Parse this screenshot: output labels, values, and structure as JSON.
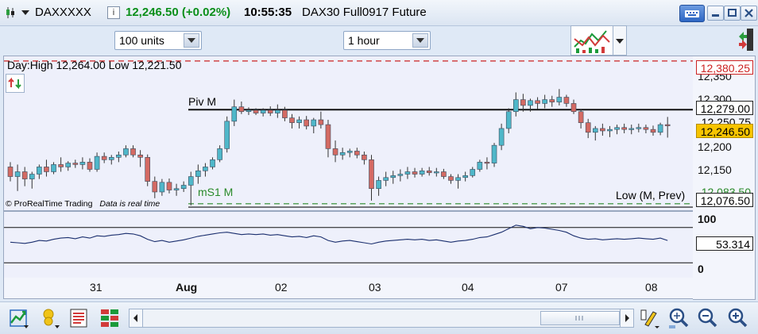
{
  "titlebar": {
    "symbol": "DAXXXXX",
    "price_change": "12,246.50 (+0.02%)",
    "time": "10:55:35",
    "instrument": "DAX30 Full0917 Future",
    "colors": {
      "price_change": "#0b8f1a"
    }
  },
  "toolbar": {
    "units_select": "100 units",
    "timeframe_select": "1 hour"
  },
  "chart": {
    "day_range": "Day:High 12,264.00 Low 12,221.50",
    "piv_label": "Piv M",
    "ms1_label": "mS1 M",
    "low_label": "Low (M, Prev)",
    "footer": "© ProRealTime Trading",
    "footer_note": "Data is real time",
    "oscillator_value": "53.314",
    "colors": {
      "up": "#4fb7c9",
      "down": "#d46a63",
      "resistance": "#cc2222",
      "support": "#2a8a2a",
      "current": "#f6c400"
    }
  },
  "chart_data": {
    "type": "candlestick",
    "x_ticks": [
      "31",
      "Aug",
      "02",
      "03",
      "04",
      "07",
      "08"
    ],
    "y_ticks": [
      12350,
      12300,
      12250,
      12200,
      12150,
      12100
    ],
    "ylim": [
      12070,
      12390
    ],
    "levels": [
      {
        "label": "12,380.25",
        "value": 12380.25
      },
      {
        "label": "12,279.00",
        "value": 12279.0
      },
      {
        "label": "12,250.75",
        "value": 12250.75
      },
      {
        "label": "12,246.50",
        "value": 12246.5
      },
      {
        "label": "12,083.50",
        "value": 12083.5
      },
      {
        "label": "12,076.50",
        "value": 12076.5
      }
    ],
    "osc_ticks": [
      "100",
      "0"
    ],
    "osc_range": [
      0,
      100
    ],
    "osc_bands": [
      80,
      20
    ],
    "candles": [
      [
        12160,
        12170,
        12130,
        12140
      ],
      [
        12140,
        12165,
        12110,
        12150
      ],
      [
        12150,
        12160,
        12120,
        12135
      ],
      [
        12135,
        12150,
        12115,
        12145
      ],
      [
        12145,
        12165,
        12135,
        12160
      ],
      [
        12160,
        12175,
        12140,
        12150
      ],
      [
        12150,
        12170,
        12145,
        12165
      ],
      [
        12165,
        12180,
        12150,
        12160
      ],
      [
        12160,
        12172,
        12152,
        12168
      ],
      [
        12168,
        12175,
        12158,
        12165
      ],
      [
        12165,
        12180,
        12155,
        12170
      ],
      [
        12170,
        12178,
        12150,
        12155
      ],
      [
        12155,
        12190,
        12150,
        12182
      ],
      [
        12182,
        12190,
        12168,
        12175
      ],
      [
        12175,
        12185,
        12165,
        12180
      ],
      [
        12180,
        12192,
        12170,
        12185
      ],
      [
        12185,
        12205,
        12180,
        12198
      ],
      [
        12198,
        12205,
        12180,
        12185
      ],
      [
        12185,
        12195,
        12160,
        12180
      ],
      [
        12180,
        12186,
        12120,
        12130
      ],
      [
        12130,
        12140,
        12095,
        12108
      ],
      [
        12108,
        12135,
        12100,
        12128
      ],
      [
        12128,
        12136,
        12105,
        12112
      ],
      [
        12112,
        12125,
        12100,
        12115
      ],
      [
        12115,
        12130,
        12108,
        12122
      ],
      [
        12122,
        12150,
        12080,
        12140
      ],
      [
        12140,
        12165,
        12125,
        12152
      ],
      [
        12152,
        12168,
        12140,
        12160
      ],
      [
        12160,
        12180,
        12155,
        12175
      ],
      [
        12175,
        12205,
        12170,
        12198
      ],
      [
        12198,
        12265,
        12190,
        12255
      ],
      [
        12255,
        12300,
        12245,
        12285
      ],
      [
        12285,
        12296,
        12270,
        12275
      ],
      [
        12275,
        12284,
        12268,
        12278
      ],
      [
        12278,
        12282,
        12268,
        12272
      ],
      [
        12272,
        12282,
        12265,
        12278
      ],
      [
        12278,
        12286,
        12266,
        12272
      ],
      [
        12272,
        12290,
        12262,
        12278
      ],
      [
        12278,
        12285,
        12255,
        12262
      ],
      [
        12262,
        12270,
        12240,
        12252
      ],
      [
        12252,
        12265,
        12240,
        12258
      ],
      [
        12258,
        12266,
        12238,
        12245
      ],
      [
        12245,
        12262,
        12230,
        12258
      ],
      [
        12258,
        12275,
        12240,
        12248
      ],
      [
        12248,
        12258,
        12180,
        12198
      ],
      [
        12198,
        12215,
        12170,
        12185
      ],
      [
        12185,
        12200,
        12175,
        12190
      ],
      [
        12190,
        12198,
        12180,
        12193
      ],
      [
        12193,
        12200,
        12178,
        12185
      ],
      [
        12185,
        12192,
        12165,
        12175
      ],
      [
        12175,
        12185,
        12090,
        12115
      ],
      [
        12115,
        12140,
        12100,
        12132
      ],
      [
        12132,
        12150,
        12120,
        12138
      ],
      [
        12138,
        12152,
        12125,
        12142
      ],
      [
        12142,
        12155,
        12130,
        12145
      ],
      [
        12145,
        12160,
        12135,
        12150
      ],
      [
        12150,
        12158,
        12138,
        12145
      ],
      [
        12145,
        12158,
        12140,
        12152
      ],
      [
        12152,
        12160,
        12142,
        12148
      ],
      [
        12148,
        12158,
        12140,
        12150
      ],
      [
        12150,
        12156,
        12135,
        12140
      ],
      [
        12140,
        12145,
        12125,
        12132
      ],
      [
        12132,
        12145,
        12115,
        12138
      ],
      [
        12138,
        12150,
        12130,
        12142
      ],
      [
        12142,
        12160,
        12138,
        12155
      ],
      [
        12155,
        12175,
        12150,
        12170
      ],
      [
        12170,
        12180,
        12155,
        12168
      ],
      [
        12168,
        12210,
        12160,
        12205
      ],
      [
        12205,
        12250,
        12195,
        12240
      ],
      [
        12240,
        12282,
        12230,
        12275
      ],
      [
        12275,
        12315,
        12265,
        12300
      ],
      [
        12300,
        12312,
        12275,
        12288
      ],
      [
        12288,
        12302,
        12275,
        12298
      ],
      [
        12298,
        12305,
        12280,
        12292
      ],
      [
        12292,
        12310,
        12282,
        12300
      ],
      [
        12300,
        12308,
        12285,
        12295
      ],
      [
        12295,
        12322,
        12288,
        12305
      ],
      [
        12305,
        12310,
        12285,
        12292
      ],
      [
        12292,
        12300,
        12270,
        12275
      ],
      [
        12275,
        12280,
        12240,
        12252
      ],
      [
        12252,
        12260,
        12220,
        12232
      ],
      [
        12232,
        12245,
        12215,
        12240
      ],
      [
        12240,
        12250,
        12225,
        12235
      ],
      [
        12235,
        12245,
        12222,
        12238
      ],
      [
        12238,
        12248,
        12228,
        12242
      ],
      [
        12242,
        12250,
        12230,
        12238
      ],
      [
        12238,
        12248,
        12228,
        12240
      ],
      [
        12240,
        12250,
        12232,
        12242
      ],
      [
        12242,
        12248,
        12230,
        12238
      ],
      [
        12238,
        12246,
        12225,
        12232
      ],
      [
        12232,
        12252,
        12226,
        12248
      ],
      [
        12248,
        12264,
        12221,
        12246
      ]
    ],
    "oscillator": [
      55,
      54,
      53,
      55,
      58,
      57,
      60,
      62,
      63,
      61,
      64,
      62,
      66,
      65,
      67,
      68,
      70,
      69,
      66,
      60,
      56,
      58,
      55,
      57,
      59,
      62,
      65,
      67,
      69,
      71,
      72,
      70,
      68,
      69,
      68,
      69,
      67,
      68,
      66,
      64,
      65,
      63,
      66,
      64,
      58,
      55,
      57,
      58,
      56,
      54,
      52,
      55,
      57,
      58,
      59,
      60,
      59,
      60,
      58,
      59,
      57,
      55,
      57,
      58,
      60,
      63,
      64,
      68,
      72,
      78,
      84,
      82,
      78,
      80,
      79,
      77,
      75,
      72,
      66,
      62,
      60,
      61,
      59,
      60,
      61,
      60,
      61,
      62,
      61,
      60,
      62,
      58
    ]
  },
  "bottombar": {
    "icons": [
      "add-indicator-icon",
      "alert-icon",
      "notes-icon",
      "layout-icon"
    ],
    "right_icons": [
      "draw-tool-icon",
      "zoom-fit-icon",
      "zoom-out-icon",
      "zoom-in-icon"
    ]
  }
}
